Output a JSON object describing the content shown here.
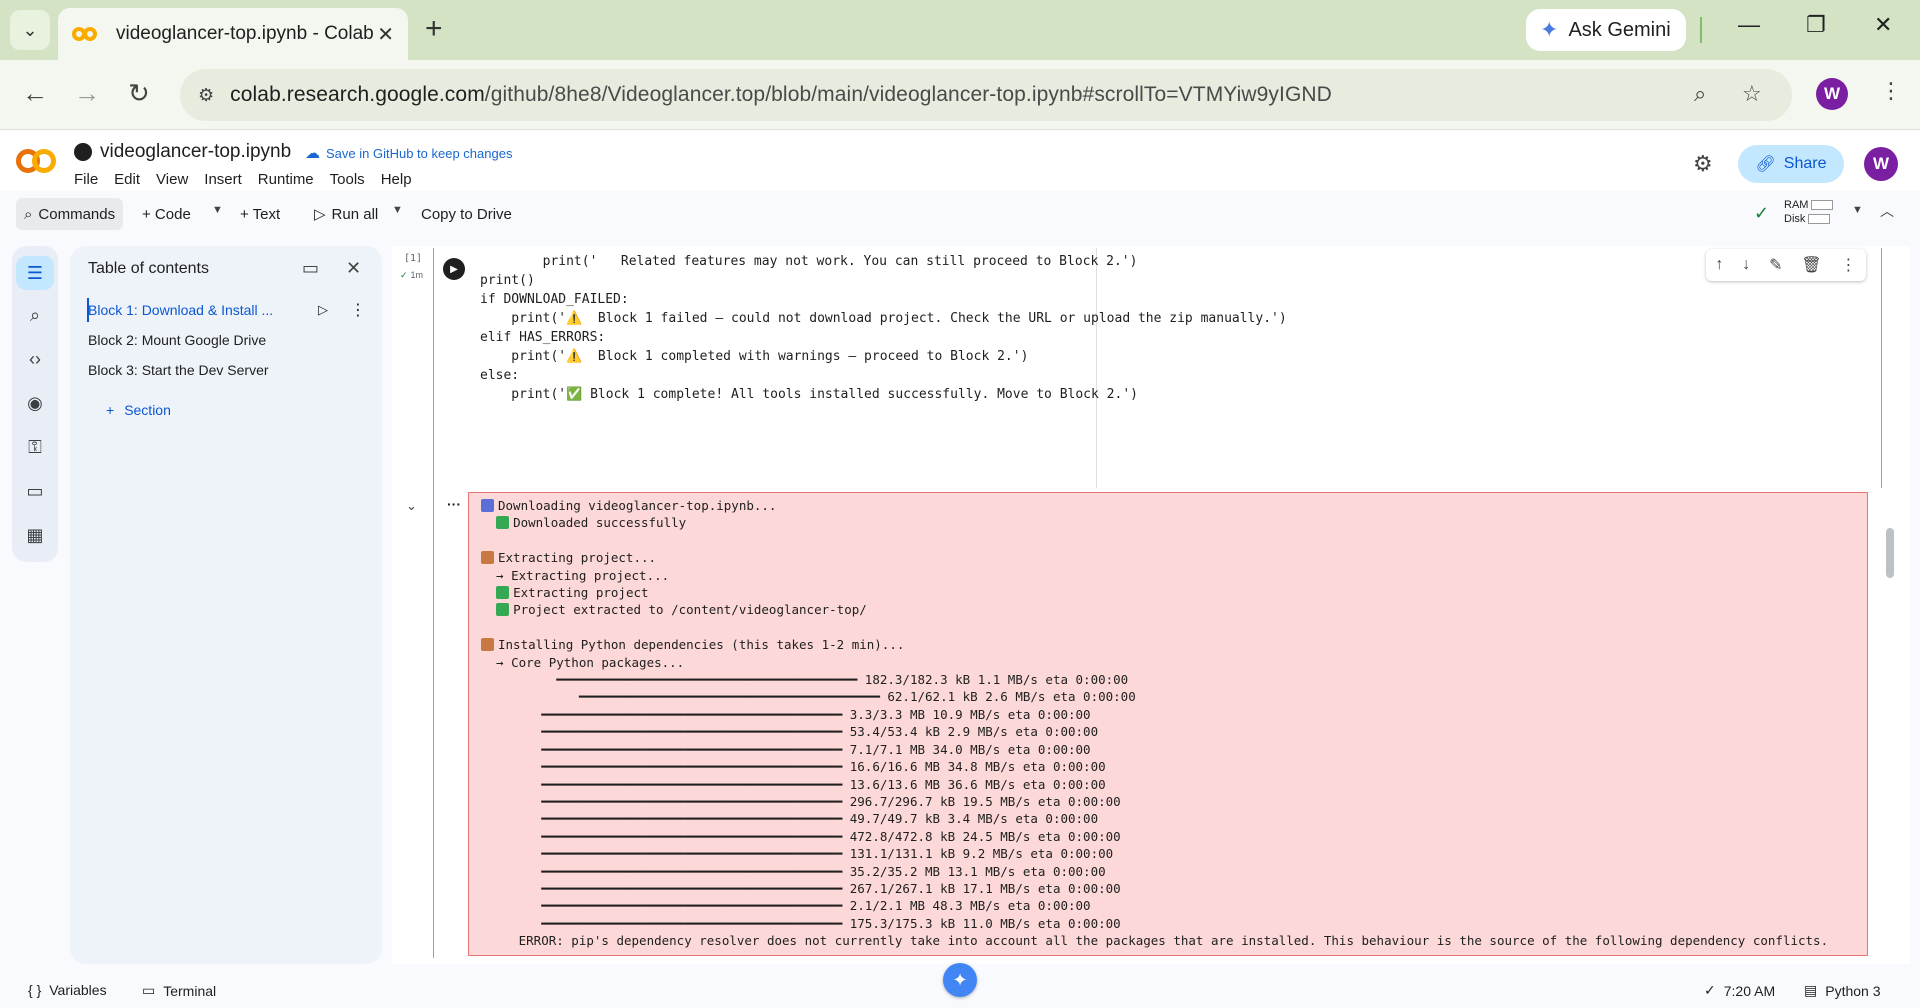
{
  "browser": {
    "tab_title": "videoglancer-top.ipynb - Colab",
    "tab_close": "✕",
    "new_tab": "+",
    "gemini_label": "Ask Gemini",
    "url_host": "colab.research.google.com",
    "url_path": "/github/8he8/Videoglancer.top/blob/main/videoglancer-top.ipynb#scrollTo=VTMYiw9yIGND",
    "profile_initial": "W",
    "minimize": "—",
    "restore": "❐",
    "close": "✕"
  },
  "colab": {
    "notebook_name": "videoglancer-top.ipynb",
    "save_github": "Save in GitHub to keep changes",
    "menu": [
      "File",
      "Edit",
      "View",
      "Insert",
      "Runtime",
      "Tools",
      "Help"
    ],
    "share_label": "Share",
    "avatar_initial": "W"
  },
  "toolbar": {
    "commands": "Commands",
    "code": "+ Code",
    "text": "+ Text",
    "run_all": "Run all",
    "copy_to_drive": "Copy to Drive",
    "ram": "RAM",
    "disk": "Disk"
  },
  "toc": {
    "title": "Table of contents",
    "items": [
      {
        "label": "Block 1: Download & Install ..."
      },
      {
        "label": "Block 2: Mount Google Drive"
      },
      {
        "label": "Block 3: Start the Dev Server"
      }
    ],
    "section_label": "Section"
  },
  "cell": {
    "exec_count": "[1]",
    "exec_time": "1m",
    "code_lines": [
      "        print('   Related features may not work. You can still proceed to Block 2.')",
      "",
      "print()",
      "if DOWNLOAD_FAILED:",
      "    print('⚠️  Block 1 failed — could not download project. Check the URL or upload the zip manually.')",
      "elif HAS_ERRORS:",
      "    print('⚠️  Block 1 completed with warnings — proceed to Block 2.')",
      "else:",
      "    print('✅ Block 1 complete! All tools installed successfully. Move to Block 2.')"
    ]
  },
  "output": {
    "lines": [
      {
        "icon": "dl",
        "text": "Downloading videoglancer-top.ipynb..."
      },
      {
        "icon": "ok",
        "indent": "  ",
        "text": "Downloaded successfully"
      },
      {
        "text": ""
      },
      {
        "icon": "box",
        "text": "Extracting project..."
      },
      {
        "text": "  → Extracting project..."
      },
      {
        "icon": "ok",
        "indent": "  ",
        "text": "Extracting project"
      },
      {
        "icon": "ok",
        "indent": "  ",
        "text": "Project extracted to /content/videoglancer-top/"
      },
      {
        "text": ""
      },
      {
        "icon": "box",
        "text": "Installing Python dependencies (this takes 1-2 min)..."
      },
      {
        "text": "  → Core Python packages..."
      },
      {
        "text": "          ━━━━━━━━━━━━━━━━━━━━━━━━━━━━━━━━━━━━━━━━ 182.3/182.3 kB 1.1 MB/s eta 0:00:00"
      },
      {
        "text": "             ━━━━━━━━━━━━━━━━━━━━━━━━━━━━━━━━━━━━━━━━ 62.1/62.1 kB 2.6 MB/s eta 0:00:00"
      },
      {
        "text": "        ━━━━━━━━━━━━━━━━━━━━━━━━━━━━━━━━━━━━━━━━ 3.3/3.3 MB 10.9 MB/s eta 0:00:00"
      },
      {
        "text": "        ━━━━━━━━━━━━━━━━━━━━━━━━━━━━━━━━━━━━━━━━ 53.4/53.4 kB 2.9 MB/s eta 0:00:00"
      },
      {
        "text": "        ━━━━━━━━━━━━━━━━━━━━━━━━━━━━━━━━━━━━━━━━ 7.1/7.1 MB 34.0 MB/s eta 0:00:00"
      },
      {
        "text": "        ━━━━━━━━━━━━━━━━━━━━━━━━━━━━━━━━━━━━━━━━ 16.6/16.6 MB 34.8 MB/s eta 0:00:00"
      },
      {
        "text": "        ━━━━━━━━━━━━━━━━━━━━━━━━━━━━━━━━━━━━━━━━ 13.6/13.6 MB 36.6 MB/s eta 0:00:00"
      },
      {
        "text": "        ━━━━━━━━━━━━━━━━━━━━━━━━━━━━━━━━━━━━━━━━ 296.7/296.7 kB 19.5 MB/s eta 0:00:00"
      },
      {
        "text": "        ━━━━━━━━━━━━━━━━━━━━━━━━━━━━━━━━━━━━━━━━ 49.7/49.7 kB 3.4 MB/s eta 0:00:00"
      },
      {
        "text": "        ━━━━━━━━━━━━━━━━━━━━━━━━━━━━━━━━━━━━━━━━ 472.8/472.8 kB 24.5 MB/s eta 0:00:00"
      },
      {
        "text": "        ━━━━━━━━━━━━━━━━━━━━━━━━━━━━━━━━━━━━━━━━ 131.1/131.1 kB 9.2 MB/s eta 0:00:00"
      },
      {
        "text": "        ━━━━━━━━━━━━━━━━━━━━━━━━━━━━━━━━━━━━━━━━ 35.2/35.2 MB 13.1 MB/s eta 0:00:00"
      },
      {
        "text": "        ━━━━━━━━━━━━━━━━━━━━━━━━━━━━━━━━━━━━━━━━ 267.1/267.1 kB 17.1 MB/s eta 0:00:00"
      },
      {
        "text": "        ━━━━━━━━━━━━━━━━━━━━━━━━━━━━━━━━━━━━━━━━ 2.1/2.1 MB 48.3 MB/s eta 0:00:00"
      },
      {
        "text": "        ━━━━━━━━━━━━━━━━━━━━━━━━━━━━━━━━━━━━━━━━ 175.3/175.3 kB 11.0 MB/s eta 0:00:00"
      },
      {
        "text": "     ERROR: pip's dependency resolver does not currently take into account all the packages that are installed. This behaviour is the source of the following dependency conflicts."
      }
    ]
  },
  "statusbar": {
    "variables": "Variables",
    "terminal": "Terminal",
    "time": "7:20 AM",
    "runtime": "Python 3"
  },
  "colors": {
    "accent": "#0b57d0",
    "error_bg": "#fdd8d8",
    "error_border": "#e57373",
    "chrome_green": "#d3e3c4"
  }
}
